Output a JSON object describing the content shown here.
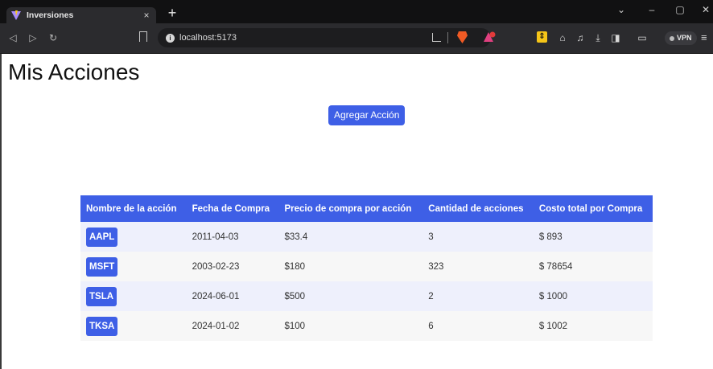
{
  "browser": {
    "tab": {
      "title": "Inversiones",
      "close": "×"
    },
    "new_tab": "+",
    "window_controls": {
      "dropdown": "⌄",
      "minimize": "–",
      "maximize": "▢",
      "close": "✕"
    },
    "nav": {
      "back": "◁",
      "forward": "▷",
      "reload": "↻"
    },
    "url": "localhost:5173",
    "vpn_label": "VPN",
    "icons": [
      "bookmark-icon",
      "site-info-icon",
      "share-icon",
      "brave-shield-icon",
      "brave-rewards-icon",
      "extension-icon",
      "puzzle-icon",
      "music-icon",
      "download-icon",
      "sidebar-icon",
      "wallet-icon",
      "menu-icon"
    ]
  },
  "page": {
    "title": "Mis Acciones",
    "add_button_label": "Agregar Acción",
    "accent_color": "#3e5fe6"
  },
  "table": {
    "headers": [
      "Nombre de la acción",
      "Fecha de Compra",
      "Precio de compra por acción",
      "Cantidad de acciones",
      "Costo total por Compra"
    ],
    "rows": [
      {
        "ticker": "AAPL",
        "date": "2011-04-03",
        "price": "$33.4",
        "quantity": "3",
        "total": "$ 893"
      },
      {
        "ticker": "MSFT",
        "date": "2003-02-23",
        "price": "$180",
        "quantity": "323",
        "total": "$ 78654"
      },
      {
        "ticker": "TSLA",
        "date": "2024-06-01",
        "price": "$500",
        "quantity": "2",
        "total": "$ 1000"
      },
      {
        "ticker": "TKSA",
        "date": "2024-01-02",
        "price": "$100",
        "quantity": "6",
        "total": "$ 1002"
      }
    ]
  }
}
